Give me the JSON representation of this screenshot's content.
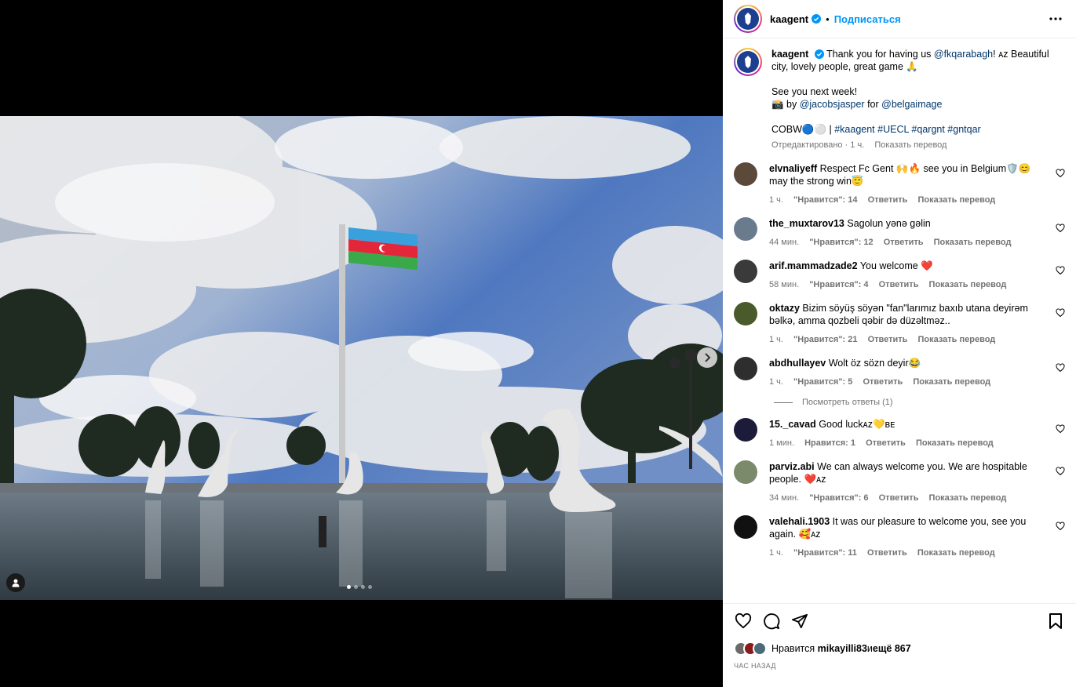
{
  "post": {
    "username": "kaagent",
    "follow_label": "Подписаться",
    "separator": "•",
    "caption": {
      "username": "kaagent",
      "line1_prefix": "Thank you for having us ",
      "mention1": "@fkqarabagh",
      "line1_suffix": "! ᴀᴢ Beautiful city, lovely people, great game 🙏",
      "line2": "See you next week!",
      "line3_prefix": "📸 by ",
      "mention2": "@jacobsjasper",
      "line3_mid": " for ",
      "mention3": "@belgaimage",
      "line4_prefix": "COBW🔵⚪ | ",
      "hashtags": "#kaagent #UECL #qargnt #gntqar",
      "edited": "Отредактировано · 1 ч.",
      "translate": "Показать перевод"
    },
    "carousel": {
      "count": 4,
      "active_index": 0
    }
  },
  "comments": [
    {
      "user": "elvnaliyeff",
      "text": "Respect Fc Gent 🙌🔥 see you in Belgium🛡️😊 may the strong win😇",
      "time": "1 ч.",
      "likes": "\"Нравится\": 14",
      "reply": "Ответить",
      "translate": "Показать перевод",
      "avatar_color": "#5b4a3a"
    },
    {
      "user": "the_muxtarov13",
      "text": "Sagolun yənə gəlin",
      "time": "44 мин.",
      "likes": "\"Нравится\": 12",
      "reply": "Ответить",
      "translate": "Показать перевод",
      "avatar_color": "#6b7b8e"
    },
    {
      "user": "arif.mammadzade2",
      "text": "You welcome ❤️",
      "time": "58 мин.",
      "likes": "\"Нравится\": 4",
      "reply": "Ответить",
      "translate": "Показать перевод",
      "avatar_color": "#3a3a3a"
    },
    {
      "user": "oktazy",
      "text": "Bizim söyüş söyən \"fan\"larımız baxıb utana deyirəm bəlkə, amma qozbeli qəbir də düzəltməz..",
      "time": "1 ч.",
      "likes": "\"Нравится\": 21",
      "reply": "Ответить",
      "translate": "Показать перевод",
      "avatar_color": "#4a5a2a"
    },
    {
      "user": "abdhullayev",
      "text": "Wolt öz sözn deyir😂",
      "time": "1 ч.",
      "likes": "\"Нравится\": 5",
      "reply": "Ответить",
      "translate": "Показать перевод",
      "avatar_color": "#2e2e2e",
      "view_replies": "Посмотреть ответы (1)"
    },
    {
      "user": "15._cavad",
      "text": "Good luckᴀᴢ💛ʙᴇ",
      "time": "1 мин.",
      "likes": "Нравится: 1",
      "reply": "Ответить",
      "translate": "Показать перевод",
      "avatar_color": "#1c1c3a"
    },
    {
      "user": "parviz.abi",
      "text": "We can always welcome you. We are hospitable people. ❤️ᴀᴢ",
      "time": "34 мин.",
      "likes": "\"Нравится\": 6",
      "reply": "Ответить",
      "translate": "Показать перевод",
      "avatar_color": "#7a8a6a"
    },
    {
      "user": "valehali.1903",
      "text": "It was our pleasure to welcome you, see you again. 🥰ᴀᴢ",
      "time": "1 ч.",
      "likes": "\"Нравится\": 11",
      "reply": "Ответить",
      "translate": "Показать перевод",
      "avatar_color": "#111111"
    }
  ],
  "footer": {
    "likes_prefix": "Нравится ",
    "likes_user": "mikayilli83",
    "likes_mid": " и ",
    "likes_rest": "ещё 867",
    "time": "ЧАС НАЗАД"
  },
  "icons": {
    "like": "heart-icon",
    "comment": "comment-icon",
    "share": "share-icon",
    "save": "bookmark-icon",
    "more": "more-icon",
    "verified": "verified-icon",
    "tag": "user-tag-icon",
    "next": "chevron-right-icon"
  },
  "colors": {
    "accent": "#0095f6",
    "link": "#00376b",
    "muted": "#737373",
    "like_red": "#ed4956"
  }
}
